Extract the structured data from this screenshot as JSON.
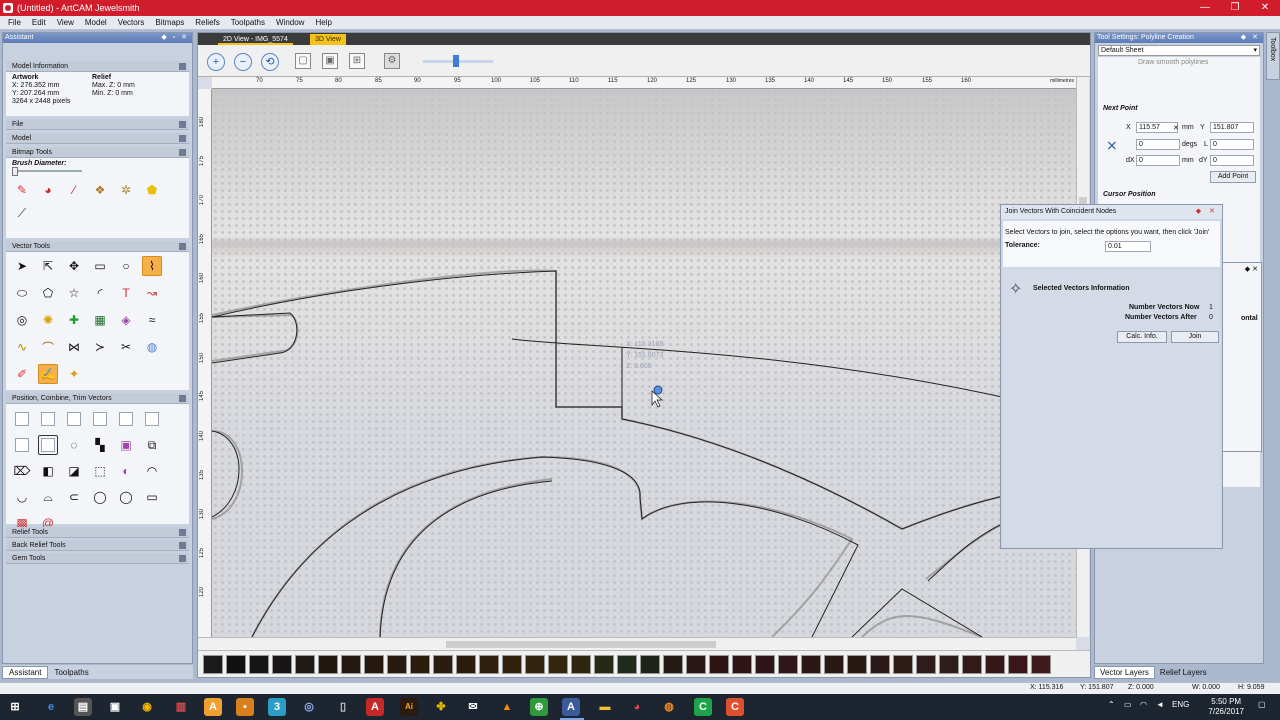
{
  "window": {
    "title": "(Untitled) - ArtCAM Jewelsmith",
    "min": "—",
    "max": "❐",
    "close": "✕"
  },
  "menu": [
    "File",
    "Edit",
    "View",
    "Model",
    "Vectors",
    "Bitmaps",
    "Reliefs",
    "Toolpaths",
    "Window",
    "Help"
  ],
  "assistant": {
    "caption": "Assistant",
    "model_information": "Model Information",
    "artwork_label": "Artwork",
    "artwork_x": "X: 276.352 mm",
    "artwork_y": "Y: 207.264 mm",
    "artwork_pixels": "3264 x 2448 pixels",
    "relief_label": "Relief",
    "relief_max": "Max. Z: 0 mm",
    "relief_min": "Min. Z: 0 mm",
    "sections": {
      "file": "File",
      "model": "Model",
      "bitmap_tools": "Bitmap Tools",
      "vector_tools": "Vector Tools",
      "position_combine": "Position, Combine, Trim Vectors",
      "relief_tools": "Relief Tools",
      "back_relief_tools": "Back Relief Tools",
      "gem_tools": "Gem Tools"
    },
    "brush_diameter": "Brush Diameter:",
    "tabs": {
      "assistant": "Assistant",
      "toolpaths": "Toolpaths"
    }
  },
  "document": {
    "tab_2d": "2D View - IMG_5574",
    "tab_3d": "3D View",
    "ruler_x": [
      "70",
      "75",
      "80",
      "85",
      "90",
      "95",
      "100",
      "105",
      "110",
      "115",
      "120",
      "125",
      "130",
      "135",
      "140",
      "145",
      "150",
      "155",
      "160"
    ],
    "ruler_y": [
      "180",
      "175",
      "170",
      "165",
      "160",
      "155",
      "150",
      "145",
      "140",
      "135",
      "130",
      "125",
      "120"
    ],
    "ruler_unit": "millimetres",
    "cursor_x": "X: 115.3168",
    "cursor_y": "Y: 151.8073",
    "cursor_z": "Z: 0.000"
  },
  "palette_colors": [
    "#1a1a1a",
    "#111111",
    "#151515",
    "#191515",
    "#1f1814",
    "#21170f",
    "#231710",
    "#24180f",
    "#281a0e",
    "#2b1d0d",
    "#2b1c10",
    "#2a1b0c",
    "#2e1f0c",
    "#30210c",
    "#32230e",
    "#34250f",
    "#2f2410",
    "#252a16",
    "#202a1a",
    "#1c2418",
    "#241c14",
    "#2a1616",
    "#2c1414",
    "#2e1417",
    "#2f1519",
    "#301618",
    "#2d1716",
    "#2a1815",
    "#281915",
    "#2b1a17",
    "#2d1b18",
    "#2e1c1a",
    "#2f1d1b",
    "#32191a",
    "#351718",
    "#3a1618",
    "#401a1c"
  ],
  "tool_settings": {
    "caption": "Tool Settings: Polyline Creation",
    "sheet": "Default Sheet",
    "smooth": "Draw smooth polylines",
    "next_point": "Next Point",
    "x_label": "X",
    "x_value": "115.57",
    "x_unit": "mm",
    "y_label": "Y",
    "y_value": "151.807",
    "a_value": "0",
    "a_unit": "degs",
    "l_label": "L",
    "l_value": "0",
    "dx_label": "dX",
    "dx_value": "0",
    "dx_unit": "mm",
    "dy_label": "dY",
    "dy_value": "0",
    "add_point": "Add Point",
    "cursor_position": "Cursor Position",
    "partial_text": "ontal",
    "tabs": {
      "vector_layers": "Vector Layers",
      "relief_layers": "Relief Layers"
    },
    "side_tab": "Toolbox"
  },
  "join_dialog": {
    "title": "Join Vectors With Coincident Nodes",
    "instruction": "Select Vectors to join, select the options you want, then click 'Join'",
    "tolerance_label": "Tolerance:",
    "tolerance_value": "0.01",
    "selected_info": "Selected Vectors Information",
    "vectors_now_label": "Number Vectors Now",
    "vectors_now_value": "1",
    "vectors_after_label": "Number Vectors After",
    "vectors_after_value": "0",
    "calc_button": "Calc. Info.",
    "join_button": "Join"
  },
  "status": {
    "x": "X: 115.316",
    "y": "Y: 151.807",
    "z": "Z: 0.000",
    "w": "W: 0.000",
    "h": "H: 9.059"
  },
  "taskbar": {
    "lang": "ENG",
    "time": "5:50 PM",
    "date": "7/26/2017"
  }
}
